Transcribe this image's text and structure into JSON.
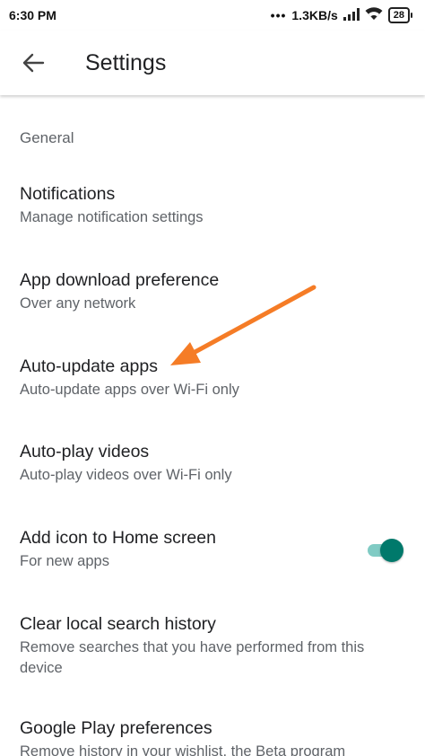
{
  "status_bar": {
    "time": "6:30 PM",
    "speed": "1.3KB/s",
    "battery": "28"
  },
  "app_bar": {
    "title": "Settings"
  },
  "section": {
    "title": "General"
  },
  "settings": [
    {
      "title": "Notifications",
      "subtitle": "Manage notification settings"
    },
    {
      "title": "App download preference",
      "subtitle": "Over any network"
    },
    {
      "title": "Auto-update apps",
      "subtitle": "Auto-update apps over Wi-Fi only"
    },
    {
      "title": "Auto-play videos",
      "subtitle": "Auto-play videos over Wi-Fi only"
    },
    {
      "title": "Add icon to Home screen",
      "subtitle": "For new apps",
      "toggle_on": true
    },
    {
      "title": "Clear local search history",
      "subtitle": "Remove searches that you have performed from this device"
    },
    {
      "title": "Google Play preferences",
      "subtitle": "Remove history in your wishlist, the Beta program"
    }
  ],
  "colors": {
    "accent": "#00796b",
    "accent_light": "#80cbc4",
    "annotation_arrow": "#f57c26"
  }
}
